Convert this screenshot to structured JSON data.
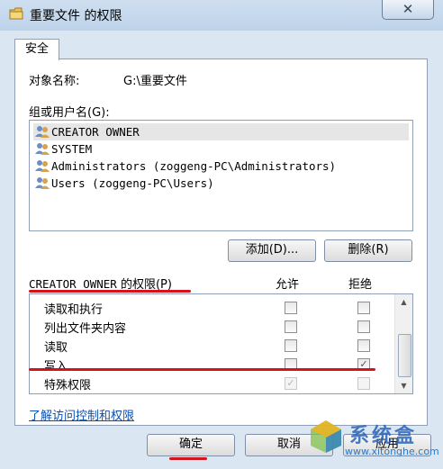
{
  "window": {
    "title": "重要文件 的权限",
    "close_glyph": "✕"
  },
  "tab": {
    "label": "安全"
  },
  "object": {
    "label": "对象名称:",
    "value": "G:\\重要文件"
  },
  "groups": {
    "label": "组或用户名(G):",
    "users": [
      "CREATOR OWNER",
      "SYSTEM",
      "Administrators (zoggeng-PC\\Administrators)",
      "Users (zoggeng-PC\\Users)"
    ],
    "selected_index": 0
  },
  "buttons": {
    "add": "添加(D)...",
    "remove": "删除(R)",
    "ok": "确定",
    "cancel": "取消",
    "apply": "应用"
  },
  "permissions": {
    "title_owner": "CREATOR OWNER",
    "title_suffix": " 的权限(P)",
    "allow_header": "允许",
    "deny_header": "拒绝",
    "rows": [
      {
        "name": "读取和执行",
        "allow": false,
        "deny": false,
        "disabled": false
      },
      {
        "name": "列出文件夹内容",
        "allow": false,
        "deny": false,
        "disabled": false
      },
      {
        "name": "读取",
        "allow": false,
        "deny": false,
        "disabled": false
      },
      {
        "name": "写入",
        "allow": false,
        "deny": true,
        "disabled": false
      },
      {
        "name": "特殊权限",
        "allow": true,
        "deny": false,
        "disabled": true
      }
    ]
  },
  "link": {
    "label": "了解访问控制和权限"
  },
  "watermark": {
    "title": "系统盒",
    "url": "www.xitonghe.com"
  },
  "colors": {
    "annotation_red": "#d4141d",
    "link_blue": "#0a4fb0",
    "window_bg": "#dbe6f3"
  }
}
